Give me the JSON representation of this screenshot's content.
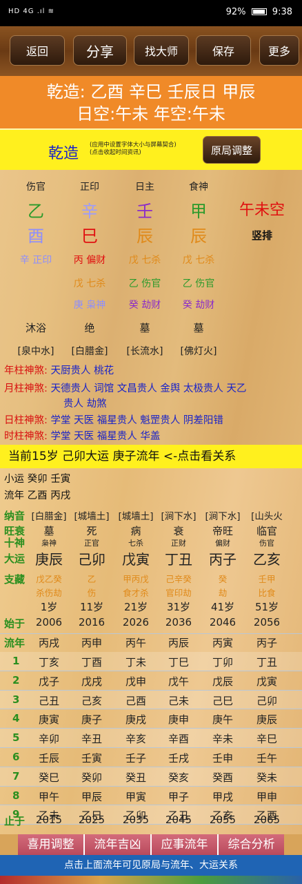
{
  "status": {
    "left": "HD 4G .ıl ≋",
    "battery": "92%",
    "time": "9:38"
  },
  "toolbar": {
    "back": "返回",
    "share": "分享",
    "master": "找大师",
    "save": "保存",
    "more": "更多"
  },
  "header": {
    "line1": "乾造: 乙酉 辛巳 壬辰日 甲辰",
    "line2": "日空:午未 年空:午未"
  },
  "ybar": {
    "title": "乾造",
    "hint1": "(应用中设置字体大小与屏幕契合)",
    "hint2": "(点击收起时间资讯)",
    "adjust": "原局调整"
  },
  "chart": {
    "labels": [
      "伤官",
      "正印",
      "日主",
      "食神"
    ],
    "stems": [
      "乙",
      "辛",
      "壬",
      "甲"
    ],
    "stem_colors": [
      "#2b9a2b",
      "#9b9bff",
      "#8b2cc9",
      "#2b9a2b"
    ],
    "empty": "午未空",
    "branches": [
      "酉",
      "巳",
      "辰",
      "辰"
    ],
    "branch_colors": [
      "#8e8efc",
      "#e01010",
      "#e08a1a",
      "#e08a1a"
    ],
    "vertical": "竖排",
    "hide1": [
      "辛 正印",
      "丙 偏财",
      "戊 七杀",
      "戊 七杀"
    ],
    "hide1_colors": [
      "#8e8efc",
      "#e01010",
      "#e08a1a",
      "#e08a1a"
    ],
    "hide2": [
      "",
      "戊 七杀",
      "乙 伤官",
      "乙 伤官"
    ],
    "hide2_colors": [
      "",
      "#e08a1a",
      "#2b9a2b",
      "#2b9a2b"
    ],
    "hide3": [
      "",
      "庚 枭神",
      "癸 劫财",
      "癸 劫财"
    ],
    "hide3_colors": [
      "",
      "#8e8efc",
      "#8b2cc9",
      "#8b2cc9"
    ],
    "stages": [
      "沐浴",
      "绝",
      "墓",
      "墓"
    ],
    "nayin": [
      "[泉中水]",
      "[白腊金]",
      "[长流水]",
      "[佛灯火]"
    ]
  },
  "shensha": {
    "year_k": "年柱神煞:",
    "year_v": "天厨贵人 桃花",
    "month_k": "月柱神煞:",
    "month_v": "天德贵人 词馆 文昌贵人 金舆 太极贵人 天乙",
    "month_v2": "贵人 劫煞",
    "day_k": "日柱神煞:",
    "day_v": "学堂 天医 福星贵人 魁罡贵人 阴差阳错",
    "hour_k": "时柱神煞:",
    "hour_v": "学堂 天医 福星贵人 华盖"
  },
  "current": "当前15岁 己卯大运 庚子流年  <-点击看关系",
  "xiaoyun": "小运  癸卯 壬寅",
  "liunian": "流年  乙酉 丙戌",
  "dayun": {
    "row_labels": {
      "nayin": "纳音",
      "wangshuai": "旺衰",
      "shishen": "十神",
      "dayun": "大运",
      "zhicang": "支藏",
      "shiyu": "始于",
      "liunian": "流年",
      "zhiyu": "止于"
    },
    "nayin": [
      "[白腊金]",
      "[城墙土]",
      "[城墙土]",
      "[涧下水]",
      "[涧下水]",
      "[山头火"
    ],
    "wangshuai": [
      "墓",
      "死",
      "病",
      "衰",
      "帝旺",
      "临官"
    ],
    "shishen": [
      "枭神",
      "正官",
      "七杀",
      "正财",
      "偏财",
      "伤官"
    ],
    "dayun": [
      "庚辰",
      "己卯",
      "戊寅",
      "丁丑",
      "丙子",
      "乙亥"
    ],
    "dayun_colors": [
      "#222",
      "#222",
      "#222",
      "#222",
      "#222",
      "#222"
    ],
    "zhicang1": [
      "戊乙癸",
      "乙",
      "甲丙戊",
      "己辛癸",
      "癸",
      "壬甲"
    ],
    "zhicang2": [
      "杀伤劫",
      "伤",
      "食才杀",
      "官印劫",
      "劫",
      "比食"
    ],
    "ages": [
      "1岁",
      "11岁",
      "21岁",
      "31岁",
      "41岁",
      "51岁"
    ],
    "shiyu": [
      "2006",
      "2016",
      "2026",
      "2036",
      "2046",
      "2056"
    ],
    "liunian_head": [
      "丙戌",
      "丙申",
      "丙午",
      "丙辰",
      "丙寅",
      "丙子"
    ],
    "rows": [
      {
        "n": "1",
        "v": [
          "丁亥",
          "丁酉",
          "丁未",
          "丁巳",
          "丁卯",
          "丁丑"
        ]
      },
      {
        "n": "2",
        "v": [
          "戊子",
          "戊戌",
          "戊申",
          "戊午",
          "戊辰",
          "戊寅"
        ]
      },
      {
        "n": "3",
        "v": [
          "己丑",
          "己亥",
          "己酉",
          "己未",
          "己巳",
          "己卯"
        ]
      },
      {
        "n": "4",
        "v": [
          "庚寅",
          "庚子",
          "庚戌",
          "庚申",
          "庚午",
          "庚辰"
        ]
      },
      {
        "n": "5",
        "v": [
          "辛卯",
          "辛丑",
          "辛亥",
          "辛酉",
          "辛未",
          "辛巳"
        ]
      },
      {
        "n": "6",
        "v": [
          "壬辰",
          "壬寅",
          "壬子",
          "壬戌",
          "壬申",
          "壬午"
        ]
      },
      {
        "n": "7",
        "v": [
          "癸巳",
          "癸卯",
          "癸丑",
          "癸亥",
          "癸酉",
          "癸未"
        ]
      },
      {
        "n": "8",
        "v": [
          "甲午",
          "甲辰",
          "甲寅",
          "甲子",
          "甲戌",
          "甲申"
        ]
      },
      {
        "n": "9",
        "v": [
          "乙未",
          "乙巳",
          "乙卯",
          "乙丑",
          "乙亥",
          "乙酉"
        ]
      }
    ],
    "zhiyu": [
      "2015",
      "2025",
      "2035",
      "2045",
      "2055",
      "2065"
    ]
  },
  "bottom": {
    "b1": "喜用调整",
    "b2": "流年吉凶",
    "b3": "应事流年",
    "b4": "综合分析"
  },
  "footer": "点击上面流年可见原局与流年、大运关系"
}
